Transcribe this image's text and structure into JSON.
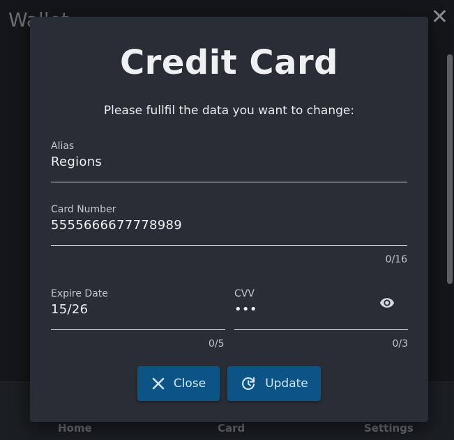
{
  "background": {
    "title": "Wallet",
    "close_glyph": "✕",
    "nav": {
      "home": "Home",
      "card": "Card",
      "settings": "Settings"
    }
  },
  "dialog": {
    "title": "Credit Card",
    "subtitle": "Please fullfil the data you want to change:",
    "fields": {
      "alias": {
        "label": "Alias",
        "value": "Regions"
      },
      "card_number": {
        "label": "Card Number",
        "value": "5555666677778989",
        "counter": "0/16"
      },
      "expire_date": {
        "label": "Expire Date",
        "value": "15/26",
        "counter": "0/5"
      },
      "cvv": {
        "label": "CVV",
        "value": "•••",
        "counter": "0/3",
        "icon": "eye-icon"
      }
    },
    "buttons": {
      "close": {
        "label": "Close",
        "icon": "close-icon"
      },
      "update": {
        "label": "Update",
        "icon": "refresh-icon"
      }
    }
  },
  "colors": {
    "dialog_bg": "#292e36",
    "button_bg": "#0c5486",
    "button_text": "#cfe4f6",
    "page_bg": "#141619"
  }
}
